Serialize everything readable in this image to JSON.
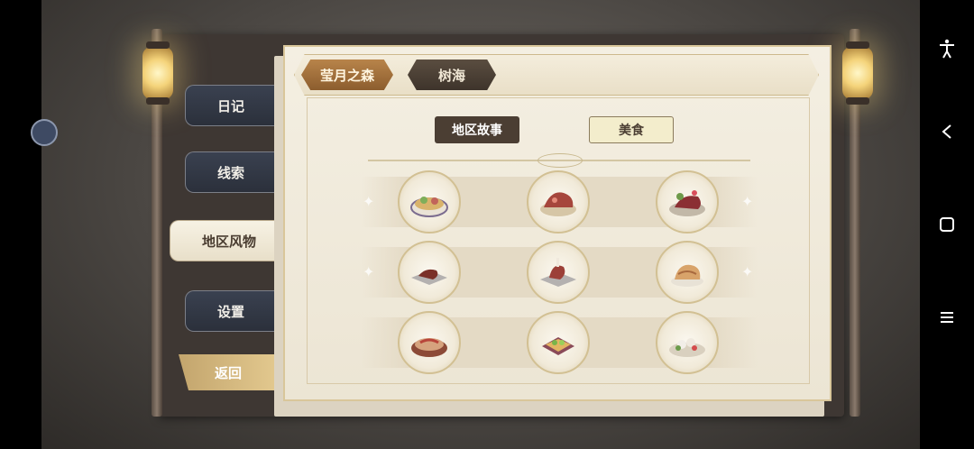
{
  "side_menu": {
    "diary": "日记",
    "clues": "线索",
    "local_customs": "地区风物",
    "settings": "设置",
    "back": "返回"
  },
  "regions": {
    "tabs": [
      "莹月之森",
      "树海"
    ],
    "selected": "莹月之森"
  },
  "category_tabs": {
    "story": "地区故事",
    "food": "美食",
    "selected": "美食"
  },
  "food_grid": [
    {
      "icon": "noodle-bowl-dish"
    },
    {
      "icon": "roast-meat-dish"
    },
    {
      "icon": "berry-meat-dish"
    },
    {
      "icon": "steak-plate-dish"
    },
    {
      "icon": "roast-drumstick-dish"
    },
    {
      "icon": "bread-pastry-dish"
    },
    {
      "icon": "hotpot-dish"
    },
    {
      "icon": "gift-box-dish"
    },
    {
      "icon": "seafood-salad-dish"
    }
  ],
  "system_nav": [
    "accessibility-icon",
    "back-icon",
    "home-icon",
    "menu-icon"
  ]
}
